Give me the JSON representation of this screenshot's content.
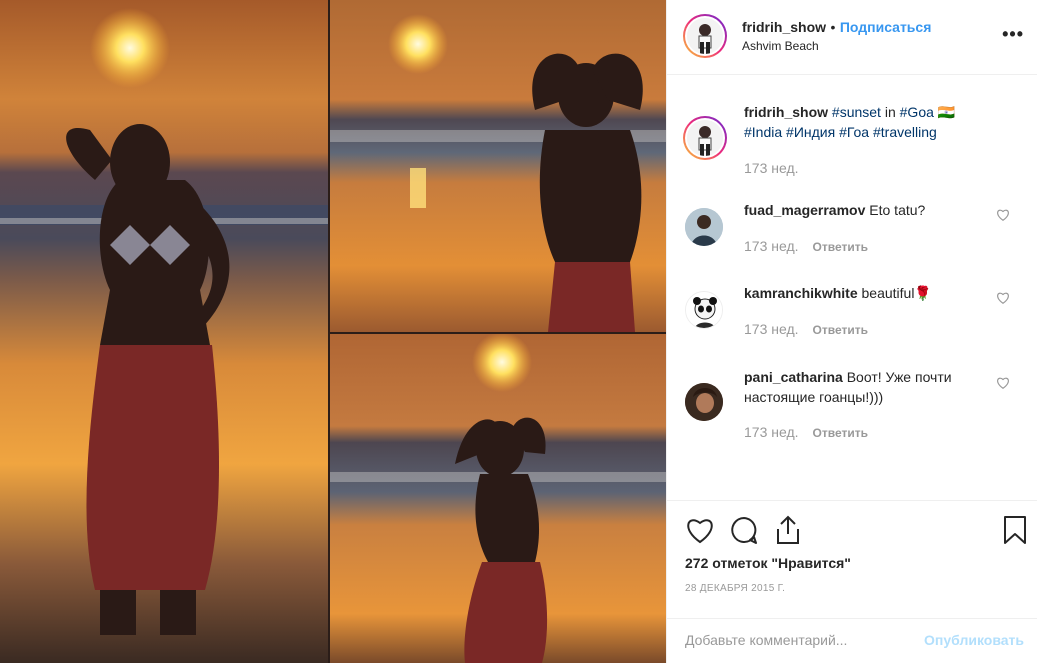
{
  "post": {
    "username": "fridrih_show",
    "follow_label": "Подписаться",
    "separator": "•",
    "location": "Ashvim Beach",
    "more_label": "•••"
  },
  "caption": {
    "username": "fridrih_show",
    "tag_sunset": "#sunset",
    "word_in": " in ",
    "tag_goa": "#Goa",
    "emoji": " 🇮🇳",
    "tag_india": "#India",
    "tag_india_ru": "#Индия",
    "tag_goa_ru": "#Гоа",
    "tag_travelling": "#travelling",
    "time": "173 нед."
  },
  "comments": [
    {
      "username": "fuad_magerramov",
      "text": "Eto tatu?",
      "time": "173 нед.",
      "reply": "Ответить"
    },
    {
      "username": "kamranchikwhite",
      "text": "beautiful🌹",
      "time": "173 нед.",
      "reply": "Ответить"
    },
    {
      "username": "pani_catharina",
      "text": "Воот! Уже почти настоящие гоанцы!)))",
      "time": "173 нед.",
      "reply": "Ответить"
    }
  ],
  "likes_text": "272 отметок \"Нравится\"",
  "date_text": "28 ДЕКАБРЯ 2015 Г.",
  "add_comment": {
    "placeholder": "Добавьте комментарий...",
    "publish_label": "Опубликовать"
  },
  "colors": {
    "accent": "#3897f0",
    "muted": "#999999",
    "hashtag": "#003569",
    "publish_disabled": "#b2dffc"
  },
  "icons": [
    "heart-icon",
    "comment-icon",
    "share-icon",
    "bookmark-icon",
    "more-icon"
  ]
}
